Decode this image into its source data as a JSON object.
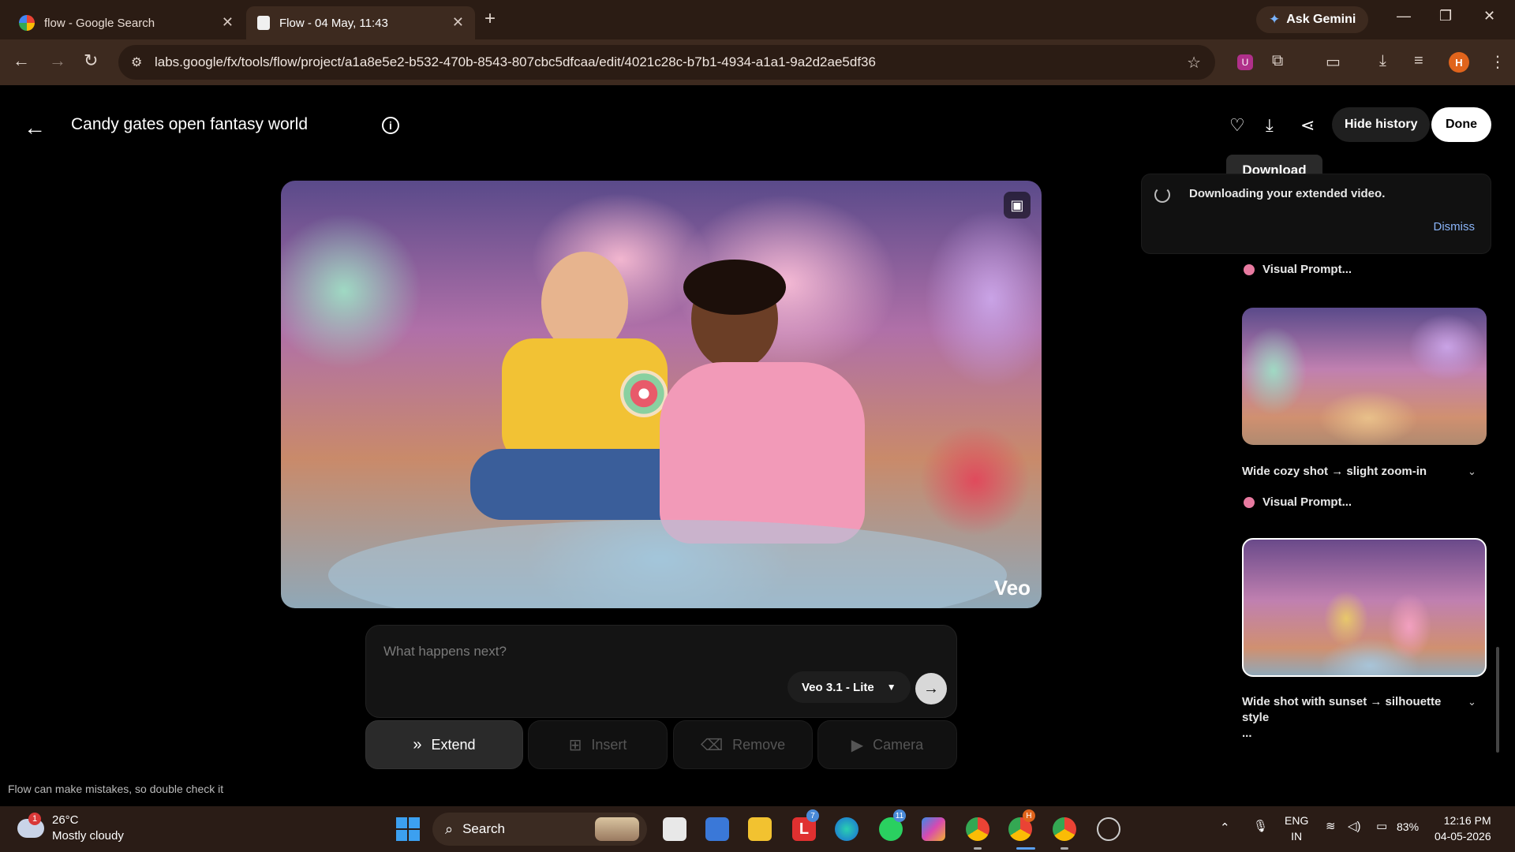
{
  "browser": {
    "tabs": [
      {
        "title": "flow - Google Search",
        "active": false
      },
      {
        "title": "Flow - 04 May, 11:43",
        "active": true
      }
    ],
    "new_tab": "+",
    "ask_gemini": "Ask Gemini",
    "url": "labs.google/fx/tools/flow/project/a1a8e5e2-b532-470b-8543-807cbc5dfcaa/edit/4021c28c-b7b1-4934-a1a1-9a2d2ae5df36",
    "profile_initial": "H",
    "extension_badge": "U"
  },
  "header": {
    "title": "Candy gates open fantasy world",
    "hide_history": "Hide history",
    "done": "Done",
    "tooltip": "Download"
  },
  "video": {
    "watermark": "Veo"
  },
  "prompt": {
    "placeholder": "What happens next?",
    "model": "Veo 3.1 - Lite"
  },
  "actions": [
    {
      "label": "Extend",
      "icon": "double-chevron-icon",
      "enabled": true
    },
    {
      "label": "Insert",
      "icon": "plus-square-icon",
      "enabled": false
    },
    {
      "label": "Remove",
      "icon": "eraser-icon",
      "enabled": false
    },
    {
      "label": "Camera",
      "icon": "video-camera-icon",
      "enabled": false
    }
  ],
  "disclaimer": "Flow can make mistakes, so double check it",
  "notification": {
    "message": "Downloading your extended video.",
    "dismiss": "Dismiss"
  },
  "history": {
    "items": [
      {
        "visual_prompt": "Visual Prompt..."
      },
      {
        "caption": "Wide cozy shot → slight zoom-in",
        "visual_prompt": "Visual Prompt..."
      },
      {
        "caption": "Wide shot with sunset → silhouette style",
        "more": "..."
      }
    ]
  },
  "taskbar": {
    "weather_badge": "1",
    "temperature": "26°C",
    "condition": "Mostly cloudy",
    "search": "Search",
    "badge_l": "7",
    "badge_whatsapp": "11",
    "badge_chrome": "H",
    "lang": "ENG",
    "region": "IN",
    "battery": "83%",
    "time": "12:16 PM",
    "date": "04-05-2026"
  },
  "colors": {
    "accent_link": "#8ab4f8",
    "tab_bar": "#2b1c14",
    "toolbar": "#3d2a1f"
  }
}
